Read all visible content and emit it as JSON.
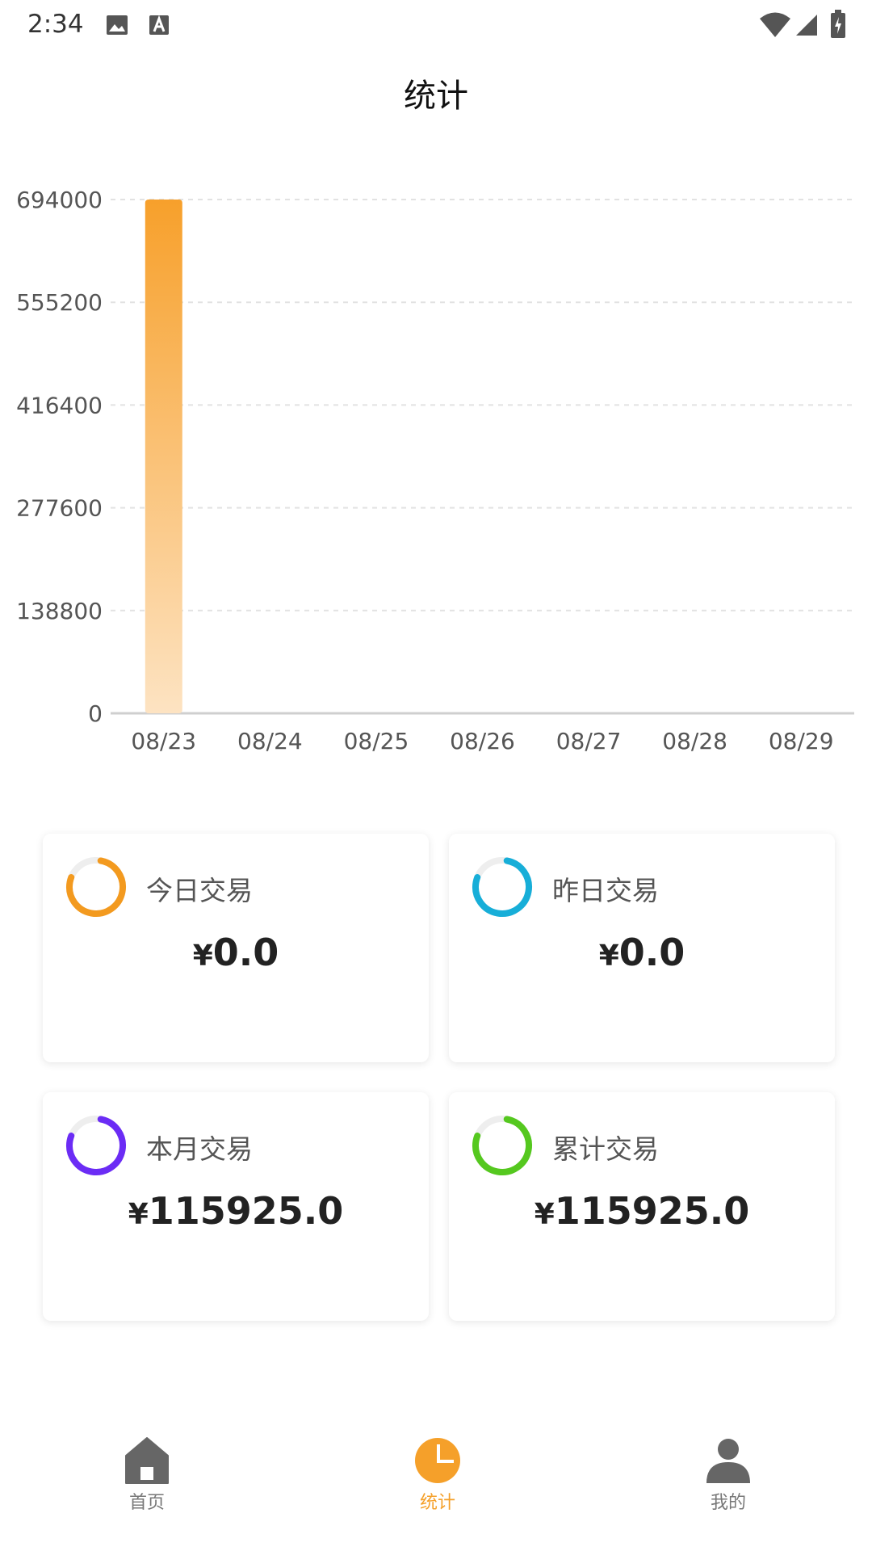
{
  "status_bar": {
    "time": "2:34",
    "icons": [
      "image-icon",
      "a-icon",
      "wifi-icon",
      "signal-icon",
      "battery-icon"
    ]
  },
  "header": {
    "title": "统计"
  },
  "chart_data": {
    "type": "bar",
    "categories": [
      "08/23",
      "08/24",
      "08/25",
      "08/26",
      "08/27",
      "08/28",
      "08/29"
    ],
    "values": [
      694000,
      0,
      0,
      0,
      0,
      0,
      0
    ],
    "y_ticks": [
      "0",
      "138800",
      "277600",
      "416400",
      "555200",
      "694000"
    ],
    "ylim": [
      0,
      694000
    ],
    "grid": true,
    "bar_color_top": "#f7a02b",
    "bar_color_bottom": "#fde3c2"
  },
  "cards": [
    {
      "label": "今日交易",
      "currency": "¥",
      "amount": "0.0",
      "ring_color": "#f39a1f"
    },
    {
      "label": "昨日交易",
      "currency": "¥",
      "amount": "0.0",
      "ring_color": "#17aed8"
    },
    {
      "label": "本月交易",
      "currency": "¥",
      "amount": "115925.0",
      "ring_color": "#6b2cf5"
    },
    {
      "label": "累计交易",
      "currency": "¥",
      "amount": "115925.0",
      "ring_color": "#55c81f"
    }
  ],
  "bottom_nav": {
    "items": [
      {
        "label": "首页",
        "icon": "home-icon",
        "active": false
      },
      {
        "label": "统计",
        "icon": "pie-chart-icon",
        "active": true
      },
      {
        "label": "我的",
        "icon": "user-icon",
        "active": false
      }
    ],
    "active_color": "#f5a02a",
    "inactive_color": "#666666"
  }
}
